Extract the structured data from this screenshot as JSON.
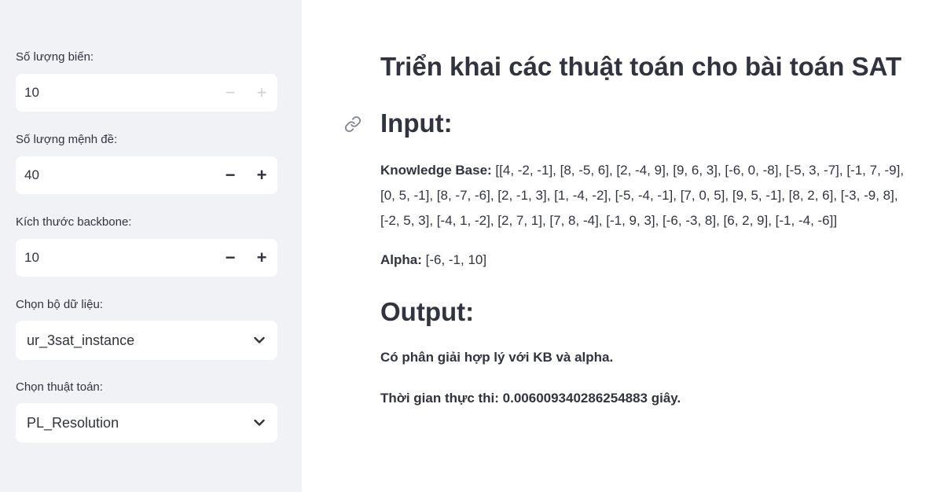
{
  "sidebar": {
    "num_vars": {
      "label": "Số lượng biến:",
      "value": "10",
      "minus": "−",
      "plus": "+"
    },
    "num_clauses": {
      "label": "Số lượng mệnh đề:",
      "value": "40",
      "minus": "−",
      "plus": "+"
    },
    "backbone": {
      "label": "Kích thước backbone:",
      "value": "10",
      "minus": "−",
      "plus": "+"
    },
    "dataset": {
      "label": "Chọn bộ dữ liệu:",
      "value": "ur_3sat_instance",
      "icon": "chevron-down-icon"
    },
    "algorithm": {
      "label": "Chọn thuật toán:",
      "value": "PL_Resolution",
      "icon": "chevron-down-icon"
    }
  },
  "main": {
    "title": "Triển khai các thuật toán cho bài toán SAT",
    "input_heading": "Input:",
    "kb_label": "Knowledge Base:",
    "kb_line1": " [[4, -2, -1], [8, -5, 6], [2, -4, 9], [9, 6, 3], [-6, 0, -8], [-5, 3, -7], [-1, 7, -9],",
    "kb_line2": "[0, 5, -1], [8, -7, -6], [2, -1, 3], [1, -4, -2], [-5, -4, -1], [7, 0, 5], [9, 5, -1], [8, 2, 6], [-3, -9, 8],",
    "kb_line3": "[-2, 5, 3], [-4, 1, -2], [2, 7, 1], [7, 8, -4], [-1, 9, 3], [-6, -3, 8], [6, 2, 9], [-1, -4, -6]]",
    "alpha_label": "Alpha:",
    "alpha_value": " [-6, -1, 10]",
    "output_heading": "Output:",
    "result": "Có phân giải hợp lý với KB và alpha.",
    "time": "Thời gian thực thi: 0.006009340286254883 giây.",
    "link_icon": "link-icon"
  }
}
